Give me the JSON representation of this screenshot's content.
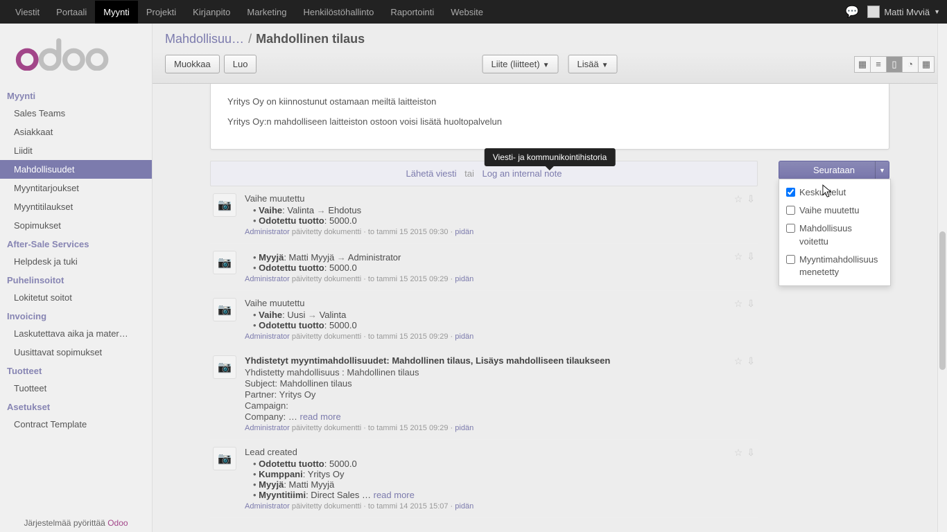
{
  "topnav": {
    "items": [
      "Viestit",
      "Portaali",
      "Myynti",
      "Projekti",
      "Kirjanpito",
      "Marketing",
      "Henkilöstöhallinto",
      "Raportointi",
      "Website"
    ],
    "active_index": 2,
    "username": "Matti Mvviä"
  },
  "sidebar": {
    "sections": [
      {
        "title": "Myynti",
        "items": [
          "Sales Teams",
          "Asiakkaat",
          "Liidit",
          "Mahdollisuudet",
          "Myyntitarjoukset",
          "Myyntitilaukset",
          "Sopimukset"
        ],
        "active_index": 3
      },
      {
        "title": "After-Sale Services",
        "items": [
          "Helpdesk ja tuki"
        ]
      },
      {
        "title": "Puhelinsoitot",
        "items": [
          "Lokitetut soitot"
        ]
      },
      {
        "title": "Invoicing",
        "items": [
          "Laskutettava aika ja mater…",
          "Uusittavat sopimukset"
        ]
      },
      {
        "title": "Tuotteet",
        "items": [
          "Tuotteet"
        ]
      },
      {
        "title": "Asetukset",
        "items": [
          "Contract Template"
        ]
      }
    ],
    "powered_prefix": "Järjestelmää pyörittää ",
    "powered_link": "Odoo"
  },
  "breadcrumb": {
    "parent": "Mahdollisuu…",
    "sep": "/",
    "current": "Mahdollinen tilaus"
  },
  "toolbar": {
    "edit": "Muokkaa",
    "create": "Luo",
    "attach": "Liite (liitteet)",
    "more": "Lisää"
  },
  "tooltip": "Viesti- ja kommunikointihistoria",
  "sheet": {
    "line1": "Yritys Oy on kiinnostunut ostamaan meiltä laitteiston",
    "line2": "Yritys Oy:n mahdolliseen laitteiston ostoon voisi lisätä huoltopalvelun"
  },
  "chatter": {
    "send": "Lähetä viesti",
    "or": "tai",
    "log": "Log an internal note",
    "keep_label": "pidän",
    "updated_label": "päivitetty dokumentti",
    "messages": [
      {
        "title": "Vaihe muutettu",
        "lines": [
          {
            "field": "Vaihe",
            "old": "Valinta",
            "new": "Ehdotus"
          },
          {
            "field": "Odotettu tuotto",
            "val": "5000.0"
          }
        ],
        "author": "Administrator",
        "ts": "to tammi 15 2015 09:30"
      },
      {
        "title": "",
        "lines": [
          {
            "field": "Myyjä",
            "old": "Matti Myyjä",
            "new": "Administrator"
          },
          {
            "field": "Odotettu tuotto",
            "val": "5000.0"
          }
        ],
        "author": "Administrator",
        "ts": "to tammi 15 2015 09:29"
      },
      {
        "title": "Vaihe muutettu",
        "lines": [
          {
            "field": "Vaihe",
            "old": "Uusi",
            "new": "Valinta"
          },
          {
            "field": "Odotettu tuotto",
            "val": "5000.0"
          }
        ],
        "author": "Administrator",
        "ts": "to tammi 15 2015 09:29"
      },
      {
        "title": "Yhdistetyt myyntimahdollisuudet: Mahdollinen tilaus, Lisäys mahdolliseen tilaukseen",
        "body": [
          "Yhdistetty mahdollisuus : Mahdollinen tilaus",
          "Subject: Mahdollinen tilaus",
          "Partner: Yritys Oy",
          "Campaign:",
          "Company: … "
        ],
        "readmore": "read more",
        "author": "Administrator",
        "ts": "to tammi 15 2015 09:29"
      },
      {
        "title": "Lead created",
        "lines": [
          {
            "field": "Odotettu tuotto",
            "val": "5000.0"
          },
          {
            "field": "Kumppani",
            "val": "Yritys Oy"
          },
          {
            "field": "Myyjä",
            "val": "Matti Myyjä"
          },
          {
            "field": "Myyntitiimi",
            "val": "Direct Sales … ",
            "readmore": "read more"
          }
        ],
        "author": "Administrator",
        "ts": "to tammi 14 2015 15:07"
      }
    ]
  },
  "follow": {
    "button": "Seurataan",
    "options": [
      {
        "label": "Keskustelut",
        "checked": true
      },
      {
        "label": "Vaihe muutettu",
        "checked": false
      },
      {
        "label": "Mahdollisuus voitettu",
        "checked": false
      },
      {
        "label": "Myyntimahdollisuus menetetty",
        "checked": false
      }
    ]
  }
}
